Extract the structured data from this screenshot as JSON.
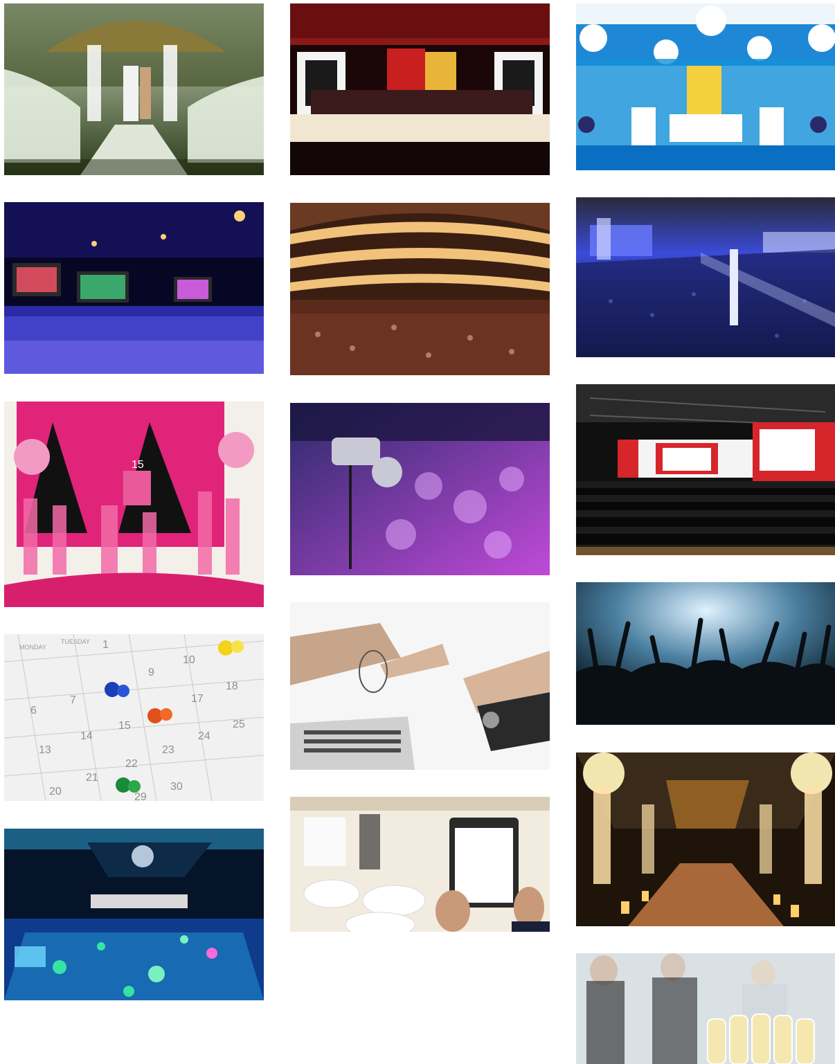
{
  "gallery": {
    "columns": [
      {
        "tiles": [
          {
            "name": "tile-garden-wedding",
            "scene": "garden-wedding",
            "colors": [
              "#2e3a1a",
              "#6b7a3a",
              "#e9efe2"
            ]
          },
          {
            "name": "tile-purple-lit-hall",
            "scene": "purple-lit-hall",
            "colors": [
              "#0a0930",
              "#3535c8",
              "#8c7cff"
            ]
          },
          {
            "name": "tile-fifteen-party",
            "scene": "fifteen-party",
            "colors": [
              "#e02a7a",
              "#111111",
              "#ffd1e6"
            ]
          },
          {
            "name": "tile-calendar-pins",
            "scene": "calendar-pins",
            "colors": [
              "#f2f2f2",
              "#a8a8a8",
              "#1a3fb8"
            ]
          },
          {
            "name": "tile-disco-dance-floor",
            "scene": "disco-dance-floor",
            "colors": [
              "#061633",
              "#1f7fb0",
              "#37e3a3"
            ]
          }
        ]
      },
      {
        "tiles": [
          {
            "name": "tile-theater-stage",
            "scene": "theater-stage",
            "colors": [
              "#2a0a08",
              "#c81f1f",
              "#f0e6d2"
            ]
          },
          {
            "name": "tile-opera-house",
            "scene": "opera-house",
            "colors": [
              "#4a2a1a",
              "#c9823a",
              "#f2c27a"
            ]
          },
          {
            "name": "tile-concert-crowd-camera",
            "scene": "concert-crowd-camera",
            "colors": [
              "#2a1a4a",
              "#a13fd8",
              "#e8b0ff"
            ]
          },
          {
            "name": "tile-business-meeting",
            "scene": "business-meeting",
            "colors": [
              "#f4f4f4",
              "#c4c4c4",
              "#3a3a3a"
            ]
          },
          {
            "name": "tile-event-planner-clipboard",
            "scene": "event-planner-clipboard",
            "colors": [
              "#f3efe7",
              "#d9cdb8",
              "#2a2a2a"
            ]
          }
        ]
      },
      {
        "tiles": [
          {
            "name": "tile-kids-party-decoration",
            "scene": "kids-party-decoration",
            "colors": [
              "#1e88d6",
              "#0a4b8c",
              "#f4d03f"
            ]
          },
          {
            "name": "tile-festival-night-crowd",
            "scene": "festival-night-crowd",
            "colors": [
              "#0b0f2a",
              "#3a4bd8",
              "#cfd6ff"
            ]
          },
          {
            "name": "tile-conference-hall",
            "scene": "conference-hall",
            "colors": [
              "#141414",
              "#d6262b",
              "#f7f7f7"
            ]
          },
          {
            "name": "tile-concert-hands",
            "scene": "concert-hands",
            "colors": [
              "#0a1a24",
              "#4a7fa0",
              "#dff2ff"
            ]
          },
          {
            "name": "tile-wedding-tent-aisle",
            "scene": "wedding-tent-aisle",
            "colors": [
              "#2a1a0a",
              "#c7822a",
              "#ffe2a8"
            ]
          },
          {
            "name": "tile-champagne-reception",
            "scene": "champagne-reception",
            "colors": [
              "#e9eef2",
              "#9aa6ad",
              "#f5e7b0"
            ]
          }
        ]
      }
    ]
  },
  "visible_text": {
    "cake_number": "15",
    "calendar": {
      "weekday_labels": [
        "MONDAY",
        "TUESDAY"
      ],
      "dates": [
        "1",
        "6",
        "7",
        "9",
        "10",
        "13",
        "14",
        "15",
        "17",
        "18",
        "20",
        "21",
        "22",
        "23",
        "24",
        "25",
        "29",
        "30"
      ]
    }
  }
}
